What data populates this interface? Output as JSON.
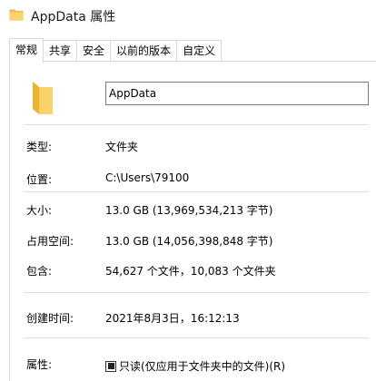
{
  "window": {
    "title": "AppData 属性"
  },
  "tabs": [
    {
      "label": "常规",
      "active": true
    },
    {
      "label": "共享",
      "active": false
    },
    {
      "label": "安全",
      "active": false
    },
    {
      "label": "以前的版本",
      "active": false
    },
    {
      "label": "自定义",
      "active": false
    }
  ],
  "general": {
    "name": "AppData",
    "type_label": "类型:",
    "type_value": "文件夹",
    "location_label": "位置:",
    "location_value": "C:\\Users\\79100",
    "size_label": "大小:",
    "size_value": "13.0 GB (13,969,534,213 字节)",
    "disk_size_label": "占用空间:",
    "disk_size_value": "13.0 GB (14,056,398,848 字节)",
    "contains_label": "包含:",
    "contains_value": "54,627 个文件，10,083 个文件夹",
    "created_label": "创建时间:",
    "created_value": "2021年8月3日，16:12:13",
    "attributes_label": "属性:",
    "readonly_label": "只读(仅应用于文件夹中的文件)(R)",
    "readonly_state": "indeterminate"
  },
  "colors": {
    "folder": "#f5c542",
    "folder_dark": "#e0a82e",
    "border": "#d9d9d9",
    "input_border": "#7a7a7a"
  }
}
